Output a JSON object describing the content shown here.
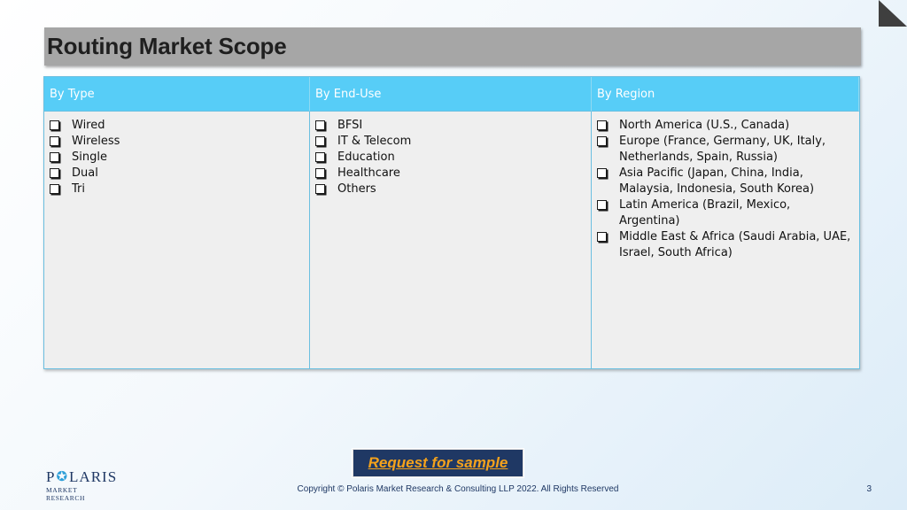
{
  "title": "Routing Market Scope",
  "columns": [
    {
      "header": "By Type",
      "items": [
        "Wired",
        "Wireless",
        "Single",
        "Dual",
        "Tri"
      ]
    },
    {
      "header": "By End-Use",
      "items": [
        "BFSI",
        "IT & Telecom",
        "Education",
        "Healthcare",
        "Others"
      ]
    },
    {
      "header": "By Region",
      "items": [
        "North America (U.S., Canada)",
        "Europe (France, Germany, UK, Italy, Netherlands, Spain, Russia)",
        "Asia Pacific (Japan, China, India, Malaysia, Indonesia, South Korea)",
        "Latin America (Brazil, Mexico, Argentina)",
        "Middle East & Africa (Saudi Arabia, UAE, Israel, South Africa)"
      ]
    }
  ],
  "cta": {
    "label": "Request for sample"
  },
  "logo": {
    "name_left": "P",
    "name_right": "LARIS",
    "subtitle": "MARKET RESEARCH"
  },
  "footer": {
    "copyright": "Copyright © Polaris Market Research & Consulting LLP 2022. All Rights Reserved",
    "page_number": "3"
  },
  "colors": {
    "title_bar": "#a6a6a6",
    "header_bg": "#57cdf7",
    "cta_bg": "#1f3864",
    "cta_text": "#f4a21c"
  }
}
